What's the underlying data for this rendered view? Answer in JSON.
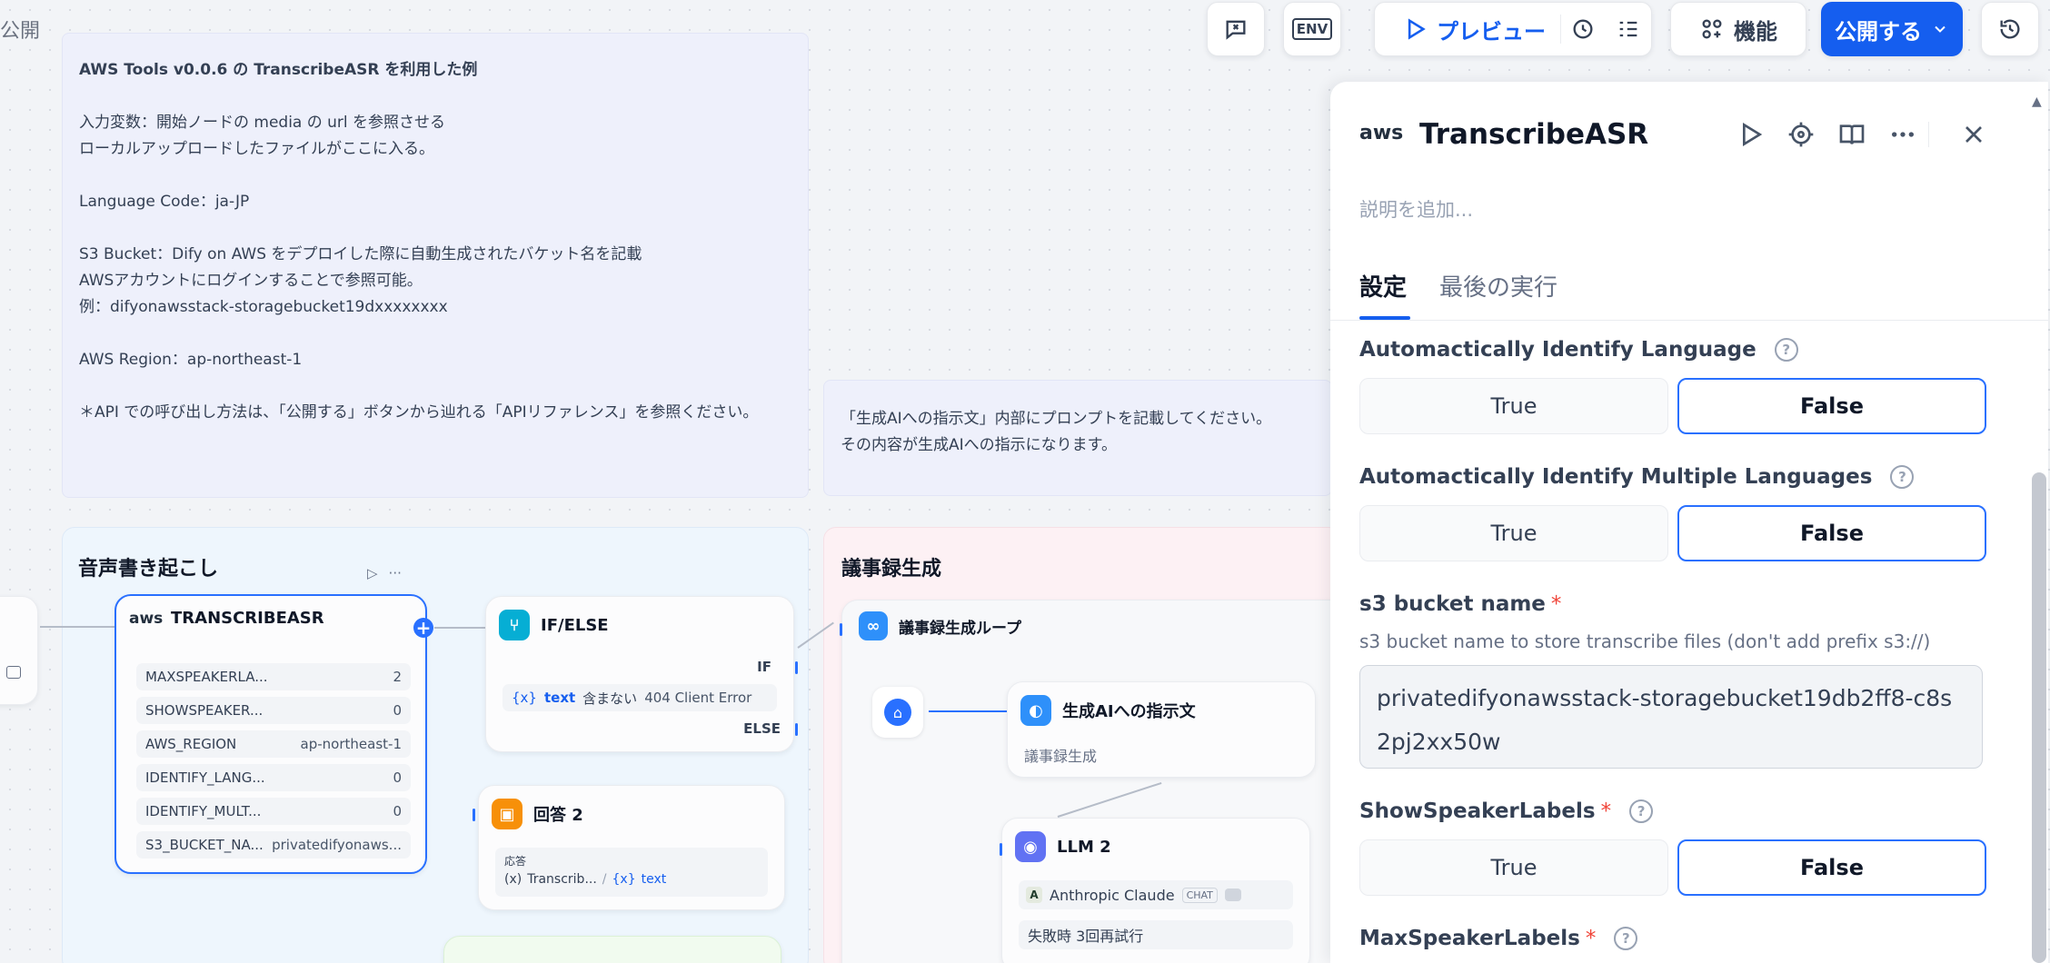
{
  "top_left_label": "公開",
  "topbar": {
    "preview_label": "プレビュー",
    "features_label": "機能",
    "publish_label": "公開する",
    "env_label": "ENV"
  },
  "notes": {
    "main": [
      "AWS Tools v0.0.6 の TranscribeASR を利用した例",
      "",
      "入力変数：開始ノードの media の url を参照させる",
      "ローカルアップロードしたファイルがここに入る。",
      "",
      "Language Code：ja-JP",
      "",
      "S3 Bucket：Dify on AWS をデプロイした際に自動生成されたバケット名を記載",
      "AWSアカウントにログインすることで参照可能。",
      "例：difyonawsstack-storagebucket19dxxxxxxxx",
      "",
      "AWS Region：ap-northeast-1",
      "",
      "＊API での呼び出し方法は、「公開する」ボタンから辿れる「APIリファレンス」を参照ください。"
    ],
    "secondary": [
      "「生成AIへの指示文」内部にプロンプトを記載してください。",
      "その内容が生成AIへの指示になります。"
    ]
  },
  "groups": {
    "transcription_title": "音声書き起こし",
    "minutes_title": "議事録生成"
  },
  "nodes": {
    "transcribe": {
      "title": "TRANSCRIBEASR",
      "logo": "aws",
      "params": [
        {
          "key": "MAXSPEAKERLA...",
          "value": "2"
        },
        {
          "key": "SHOWSPEAKER...",
          "value": "0"
        },
        {
          "key": "AWS_REGION",
          "value": "ap-northeast-1"
        },
        {
          "key": "IDENTIFY_LANG...",
          "value": "0"
        },
        {
          "key": "IDENTIFY_MULT...",
          "value": "0"
        },
        {
          "key": "S3_BUCKET_NA...",
          "value": "privatedifyonaws..."
        }
      ]
    },
    "ifelse": {
      "title": "IF/ELSE",
      "if_label": "IF",
      "else_label": "ELSE",
      "cond_var_icon": "{x}",
      "cond_var": "text",
      "cond_op": "含まない",
      "cond_value": "404 Client Error"
    },
    "answer": {
      "title": "回答 2",
      "field_label": "応答",
      "ref1_icon": "(x)",
      "ref1": "Transcrib...",
      "ref2_icon": "{x}",
      "ref2": "text"
    },
    "loop": {
      "title": "議事録生成ループ"
    },
    "prompt": {
      "title": "生成AIへの指示文",
      "subtitle": "議事録生成"
    },
    "llm": {
      "title": "LLM 2",
      "model": "Anthropic Claude",
      "model_badge": "CHAT",
      "retry": "失敗時 3回再試行"
    }
  },
  "panel": {
    "logo": "aws",
    "title": "TranscribeASR",
    "description_placeholder": "説明を追加...",
    "tabs": [
      "設定",
      "最後の実行"
    ],
    "active_tab": "設定",
    "fields": {
      "auto_lang": {
        "label": "Automactically Identify Language",
        "options": [
          "True",
          "False"
        ],
        "selected": "False"
      },
      "auto_multi": {
        "label": "Automactically Identify Multiple Languages",
        "options": [
          "True",
          "False"
        ],
        "selected": "False"
      },
      "s3_bucket": {
        "label": "s3 bucket name",
        "required_mark": "*",
        "help": "s3 bucket name to store transcribe files (don't add prefix s3://)",
        "value": "privatedifyonawsstack-storagebucket19db2ff8-c8s2pj2xx50w"
      },
      "show_speaker": {
        "label": "ShowSpeakerLabels",
        "required_mark": "*",
        "options": [
          "True",
          "False"
        ],
        "selected": "False"
      },
      "max_speaker": {
        "label": "MaxSpeakerLabels",
        "required_mark": "*"
      }
    }
  },
  "colors": {
    "accent": "#155eef",
    "selection": "#2970ff",
    "note_bg": "#eef0fb",
    "group_blue": "#eef6fd",
    "group_pink": "#fdf1f4",
    "ifelse_icon": "#06aed4",
    "answer_icon": "#f79009",
    "llm_icon": "#6172f3",
    "loop_icon": "#2e90fa"
  }
}
